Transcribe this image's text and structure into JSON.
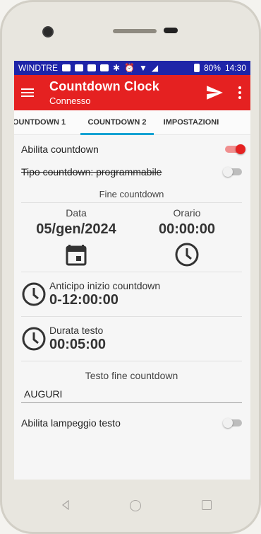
{
  "statusbar": {
    "carrier": "WINDTRE",
    "battery": "80%",
    "time": "14:30"
  },
  "appbar": {
    "title": "Countdown Clock",
    "subtitle": "Connesso"
  },
  "tabs": [
    {
      "label": "COUNTDOWN 1"
    },
    {
      "label": "COUNTDOWN 2"
    },
    {
      "label": "IMPOSTAZIONI"
    }
  ],
  "settings": {
    "abilita_countdown_label": "Abilita countdown",
    "abilita_countdown_on": true,
    "tipo_countdown_label": "Tipo countdown: programmabile",
    "tipo_countdown_on": false
  },
  "fine_countdown": {
    "section_label": "Fine countdown",
    "data_label": "Data",
    "data_value": "05/gen/2024",
    "orario_label": "Orario",
    "orario_value": "00:00:00"
  },
  "anticipo": {
    "label": "Anticipo inizio countdown",
    "value": "0-12:00:00"
  },
  "durata": {
    "label": "Durata testo",
    "value": "00:05:00"
  },
  "testo_fine": {
    "label": "Testo fine countdown",
    "value": "AUGURI"
  },
  "lampeggio": {
    "label": "Abilita lampeggio testo",
    "on": false
  },
  "colors": {
    "appbar": "#e52121",
    "statusbar": "#1e24a8",
    "tab_indicator": "#16a2d3"
  }
}
